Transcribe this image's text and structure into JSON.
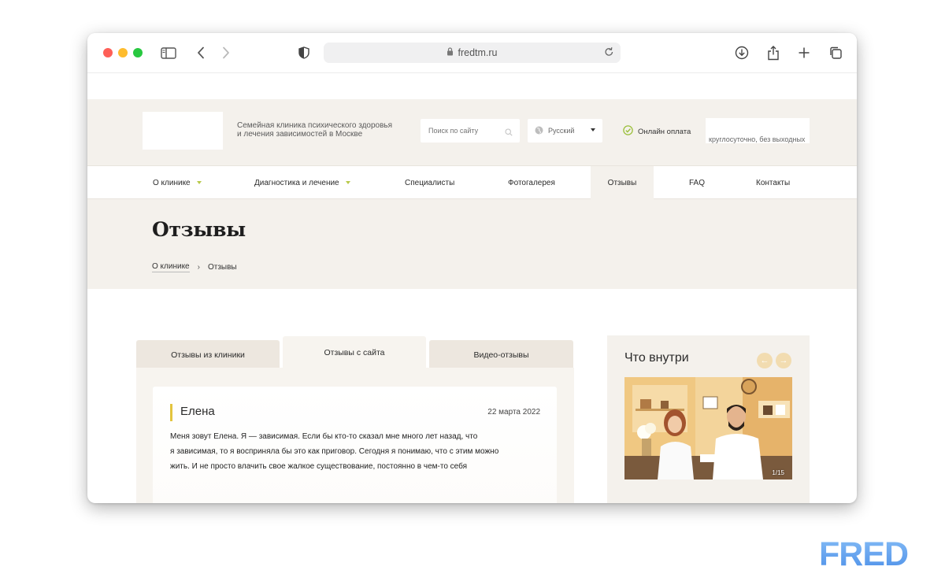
{
  "browser": {
    "url": "fredtm.ru"
  },
  "header": {
    "tagline_line1": "Семейная клиника психического здоровья",
    "tagline_line2": "и лечения зависимостей в Москве",
    "search_placeholder": "Поиск по сайту",
    "language": "Русский",
    "payment_label": "Онлайн оплата",
    "hours": "круглосуточно, без выходных"
  },
  "nav": {
    "items": [
      {
        "label": "О клинике"
      },
      {
        "label": "Диагностика и лечение"
      },
      {
        "label": "Специалисты"
      },
      {
        "label": "Фотогалерея"
      },
      {
        "label": "Отзывы"
      },
      {
        "label": "FAQ"
      },
      {
        "label": "Контакты"
      }
    ]
  },
  "page": {
    "title": "Отзывы",
    "breadcrumb": [
      "О клинике",
      "Отзывы"
    ]
  },
  "reviews": {
    "tabs": [
      {
        "label": "Отзывы из клиники"
      },
      {
        "label": "Отзывы с сайта"
      },
      {
        "label": "Видео-отзывы"
      }
    ],
    "card": {
      "name": "Елена",
      "date": "22 марта 2022",
      "line1": "Меня зовут Елена. Я — зависимая. Если бы кто-то сказал мне много лет назад, что",
      "line2": "я зависимая, то я восприняла бы это как приговор. Сегодня я понимаю, что с этим можно",
      "line3": "жить. И не просто влачить свое жалкое существование, постоянно в чем-то себя"
    }
  },
  "sidebar": {
    "title": "Что внутри",
    "counter": "1/15"
  },
  "watermark": {
    "text": "FRED",
    "color": "#6aa9f0"
  },
  "colors": {
    "accent": "#b8c94a",
    "beige": "#f4f1ec",
    "name_accent": "#e3c43e"
  }
}
